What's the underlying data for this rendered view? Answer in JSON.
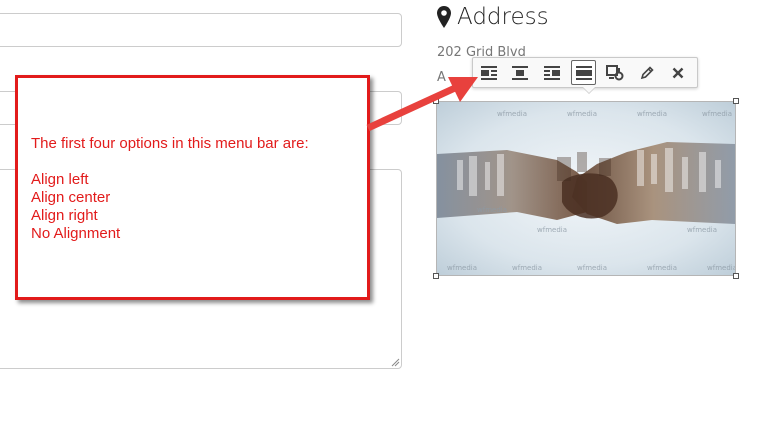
{
  "address": {
    "heading": "Address",
    "line1": "202 Grid Blvd",
    "line2": "A"
  },
  "toolbar": {
    "buttons": [
      {
        "name": "align-left",
        "icon": "align-left-icon"
      },
      {
        "name": "align-center",
        "icon": "align-center-icon"
      },
      {
        "name": "align-right",
        "icon": "align-right-icon"
      },
      {
        "name": "no-alignment",
        "icon": "align-none-icon",
        "active": true
      },
      {
        "name": "image-properties",
        "icon": "image-settings-icon"
      },
      {
        "name": "edit",
        "icon": "pencil-icon"
      },
      {
        "name": "remove",
        "icon": "close-icon"
      }
    ]
  },
  "image": {
    "watermark": "wfmedia",
    "description": "handshake"
  },
  "callout": {
    "intro": "The first four options in this menu bar are:",
    "items": [
      "Align left",
      "Align center",
      "Align right",
      "No Alignment"
    ]
  },
  "colors": {
    "annotation": "#e21b1b",
    "border": "#cccccc"
  }
}
